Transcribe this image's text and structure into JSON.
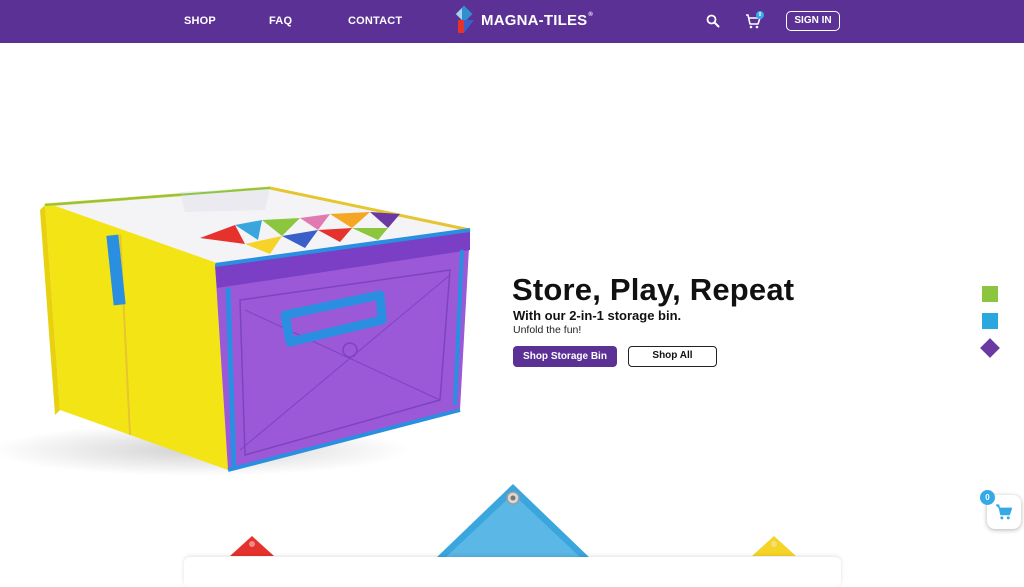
{
  "header": {
    "nav": {
      "shop": "SHOP",
      "faq": "FAQ",
      "contact": "CONTACT"
    },
    "logo_text": "MAGNA-TILES",
    "logo_reg": "®",
    "cart_count": "0",
    "sign_in": "SIGN IN",
    "icons": [
      "search-icon",
      "cart-icon"
    ]
  },
  "hero": {
    "title": "Store, Play, Repeat",
    "subtitle": "With our 2-in-1 storage bin.",
    "tagline": "Unfold the fun!",
    "primary_button": "Shop Storage Bin",
    "secondary_button": "Shop All"
  },
  "swatches": [
    {
      "name": "green",
      "color": "#8cc63f"
    },
    {
      "name": "blue",
      "color": "#29a8e0"
    },
    {
      "name": "purple",
      "color": "#6a3aa2"
    }
  ],
  "floating_cart": {
    "count": "0"
  },
  "colors": {
    "brand_purple": "#5b3196",
    "accent_blue": "#35a9e6",
    "tile_red": "#e5322d",
    "tile_blue": "#3ba6dd",
    "tile_yellow": "#f5d327"
  }
}
